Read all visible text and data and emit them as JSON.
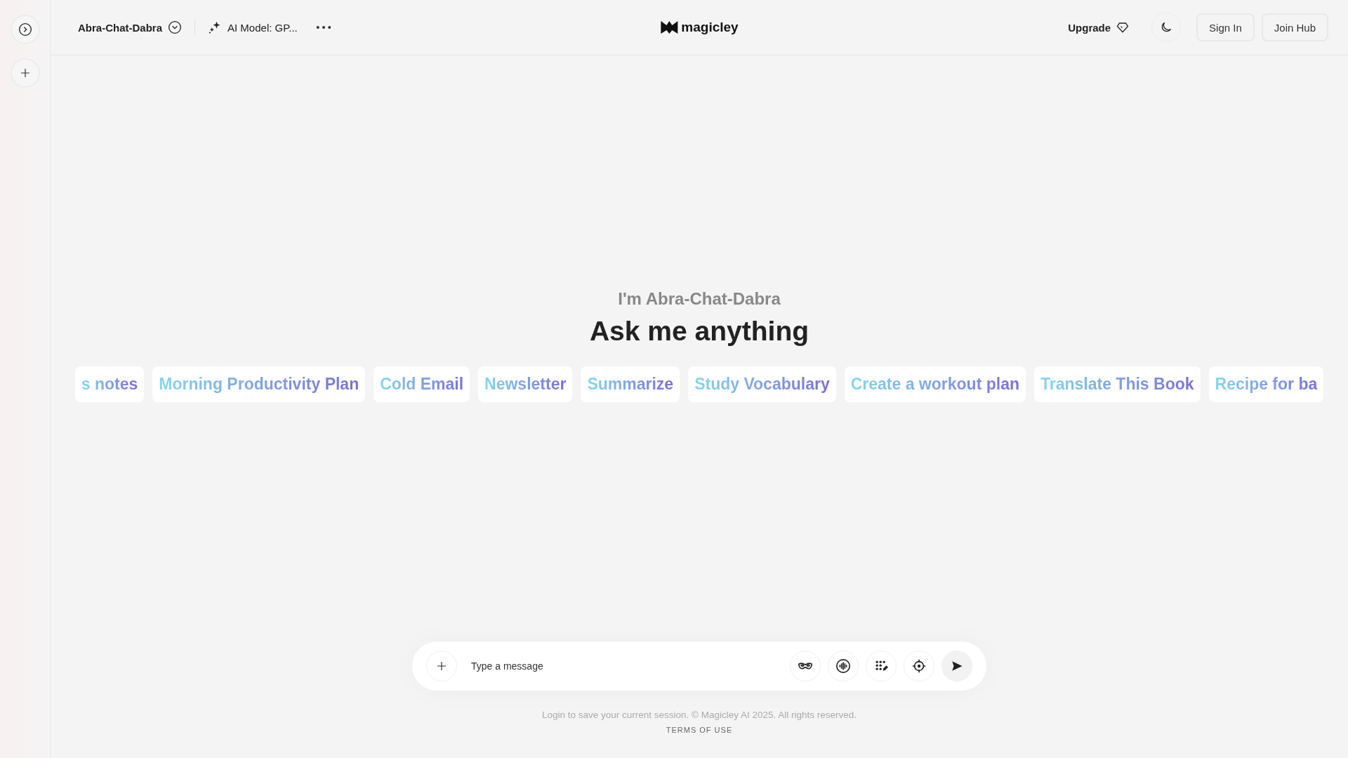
{
  "header": {
    "assistant_name": "Abra-Chat-Dabra",
    "model": "AI Model: GP...",
    "logo": "magicley",
    "upgrade": "Upgrade",
    "buttons": [
      "Sign In",
      "Join Hub"
    ]
  },
  "hero": {
    "subtitle": "I'm Abra-Chat-Dabra",
    "title": "Ask me anything"
  },
  "suggestions": [
    "s notes",
    "Morning Productivity Plan",
    "Cold Email",
    "Newsletter",
    "Summarize",
    "Study Vocabulary",
    "Create a workout plan",
    "Translate This Book",
    "Recipe for ba"
  ],
  "composer": {
    "placeholder": "Type a message"
  },
  "footer": {
    "notice": "Login to save your current session. © Magicley AI 2025. All rights reserved.",
    "link": "TERMS OF USE"
  }
}
